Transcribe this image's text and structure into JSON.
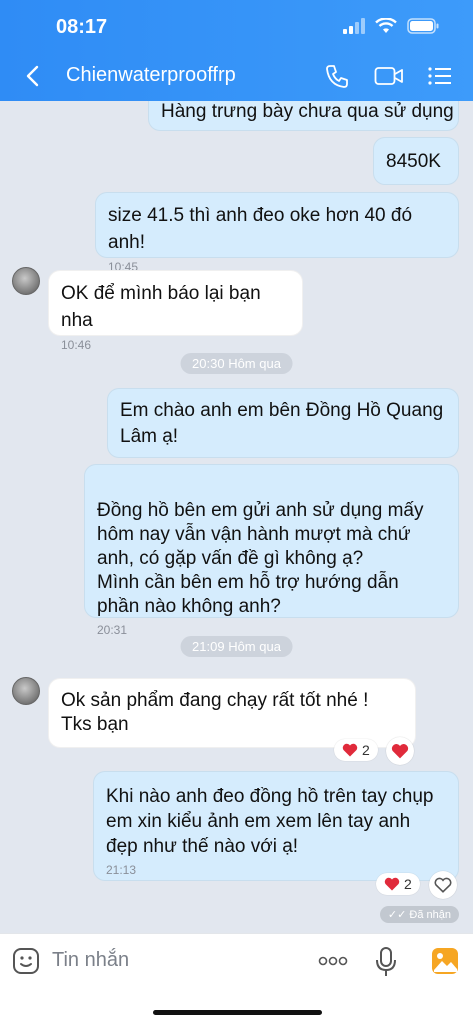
{
  "status": {
    "time": "08:17"
  },
  "header": {
    "title": "Chienwaterprooffrp"
  },
  "messages": [
    {
      "text": "Hàng trưng bày chưa qua sử dụng"
    },
    {
      "text": "8450K"
    },
    {
      "text": "size 41.5 thì anh đeo oke hơn 40 đó anh!",
      "time": "10:45"
    },
    {
      "text": "OK để mình báo lại bạn nha",
      "time": "10:46"
    },
    {
      "text": "Em chào anh  em bên Đồng Hồ Quang Lâm ạ!"
    },
    {
      "text": "Đồng hồ bên em gửi anh sử dụng mấy hôm nay vẫn vận hành mượt mà chứ anh, có gặp vấn đề gì không ạ?\nMình cần bên em hỗ trợ hướng dẫn phần nào không anh?",
      "time": "20:31"
    },
    {
      "text": "Ok sản phẩm đang chạy rất tốt nhé ! Tks bạn",
      "reaction_count": "2"
    },
    {
      "text": "Khi nào anh đeo đồng hồ  trên tay chụp em xin kiểu ảnh em xem lên tay anh đẹp như thế nào với ạ!",
      "time": "21:13",
      "reaction_count": "2"
    }
  ],
  "separators": [
    "20:30 Hôm qua",
    "21:09 Hôm qua"
  ],
  "received_label": "Đã nhận",
  "input": {
    "placeholder": "Tin nhắn"
  },
  "colors": {
    "header": "#2f8cf5",
    "outgoing": "#d5ecfd",
    "incoming": "#ffffff",
    "background": "#e2e7ef",
    "heart": "#e02a3b"
  },
  "icons": [
    "back-arrow-icon",
    "phone-icon",
    "video-call-icon",
    "menu-list-icon",
    "sticker-icon",
    "more-dots-icon",
    "microphone-icon",
    "image-icon",
    "heart-icon"
  ]
}
